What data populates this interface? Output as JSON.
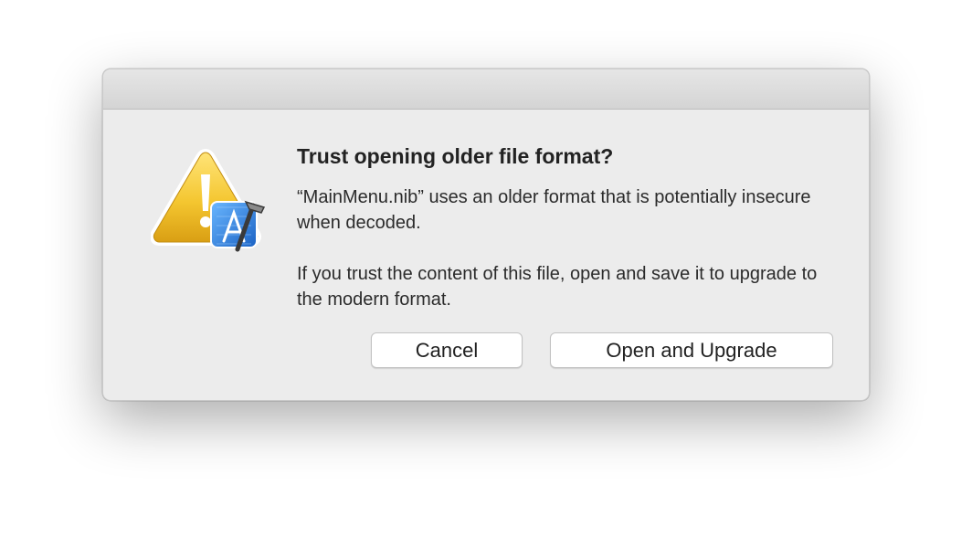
{
  "dialog": {
    "title": "Trust opening older file format?",
    "message_primary": "“MainMenu.nib” uses an older format that is potentially insecure when decoded.",
    "message_secondary": "If you trust the content of this file, open and save it to upgrade to the modern format.",
    "icon": "caution-triangle-with-xcode-badge-icon",
    "buttons": {
      "cancel_label": "Cancel",
      "confirm_label": "Open and Upgrade"
    }
  },
  "colors": {
    "dialog_background": "#ececec",
    "caution_yellow": "#f2c230",
    "xcode_blue": "#2f7fd6"
  }
}
